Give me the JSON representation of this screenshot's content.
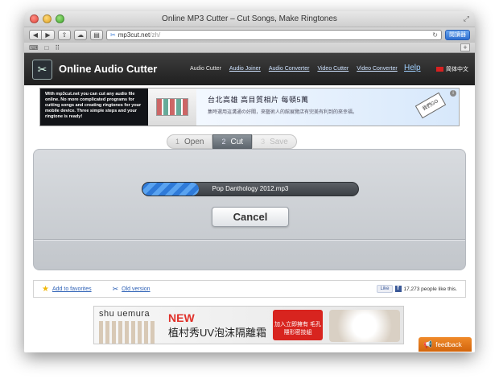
{
  "window": {
    "title": "Online MP3 Cutter – Cut Songs, Make Ringtones"
  },
  "toolbar": {
    "back": "◀",
    "forward": "▶",
    "share": "⇧",
    "url_domain": "mp3cut.net",
    "url_path": "/zh/",
    "reader_label": "閱讀器"
  },
  "bookmarks": {
    "items": [
      "⌨",
      "□",
      "⠿"
    ]
  },
  "site": {
    "name": "Online Audio Cutter",
    "nav": [
      "Audio Cutter",
      "Audio Joiner",
      "Audio Converter",
      "Video Cutter",
      "Video Converter"
    ],
    "help": "Help",
    "language": "简体中文"
  },
  "ad_top": {
    "left_text": "With mp3cut.net you can cut any audio file online. No more complicated programs for cutting songs and creating ringtones for your mobile device. Three simple steps and your ringtone is ready!",
    "headline": "台北高雄 高目質相片 每頓5萬",
    "subline": "集時選用這溝通の好關，來藝術人的館展覽店有完美有利到的來幸福。",
    "cta": "我們GO"
  },
  "steps": [
    {
      "num": "1",
      "label": "Open",
      "state": "done"
    },
    {
      "num": "2",
      "label": "Cut",
      "state": "active"
    },
    {
      "num": "3",
      "label": "Save",
      "state": "disabled"
    }
  ],
  "upload": {
    "filename": "Pop Danthology 2012.mp3",
    "progress": 0.26,
    "cancel_label": "Cancel"
  },
  "footer": {
    "favorites": "Add to favorites",
    "old_version": "Old version",
    "like": "Like",
    "like_count": "17,273 people like this."
  },
  "ad_bottom": {
    "brand": "shu uemura",
    "new_label": "NEW",
    "product": "植村秀UV泡沫隔離霜",
    "promo": "加入立即擁有 毛孔隱形密技組"
  },
  "feedback": {
    "label": "feedback"
  },
  "colors": {
    "header_bg": "#2b2b2b",
    "step_active": "#6b737b",
    "progress_fill": "#3f8ae0",
    "feedback": "#e57618",
    "link": "#2b5fb5"
  }
}
